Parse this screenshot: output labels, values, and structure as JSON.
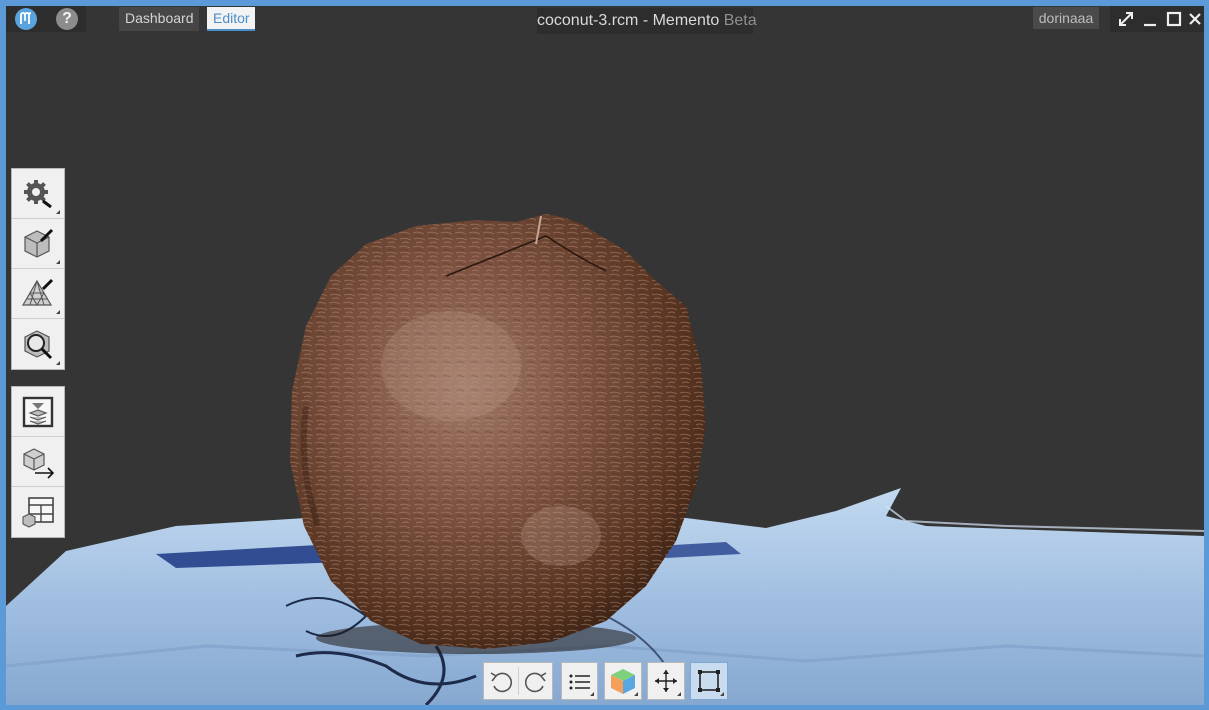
{
  "titlebar": {
    "logo_icon": "memento-logo-icon",
    "help_icon": "help-icon",
    "help_glyph": "?",
    "tabs": {
      "dashboard": "Dashboard",
      "editor": "Editor"
    },
    "window_title": "coconut-3.rcm - Memento",
    "window_title_suffix": " Beta",
    "user": "dorinaaa",
    "window_buttons": [
      "fullscreen-icon",
      "minimize-icon",
      "maximize-icon",
      "close-icon"
    ]
  },
  "left_toolbar": {
    "group1": [
      "settings-icon",
      "mesh-edit-icon",
      "wireframe-edit-icon",
      "mesh-analyze-icon"
    ],
    "group2": [
      "print-icon",
      "export-icon",
      "layout-icon"
    ]
  },
  "bottom_toolbar": [
    "undo-icon",
    "redo-icon",
    "list-icon",
    "cube-view-icon",
    "move-icon",
    "select-box-icon"
  ],
  "colors": {
    "accent": "#4a8fc9",
    "frame": "#5b9ad6",
    "background": "#353535",
    "coconut": "#6e4333",
    "cloth": "#a9c7e6"
  }
}
